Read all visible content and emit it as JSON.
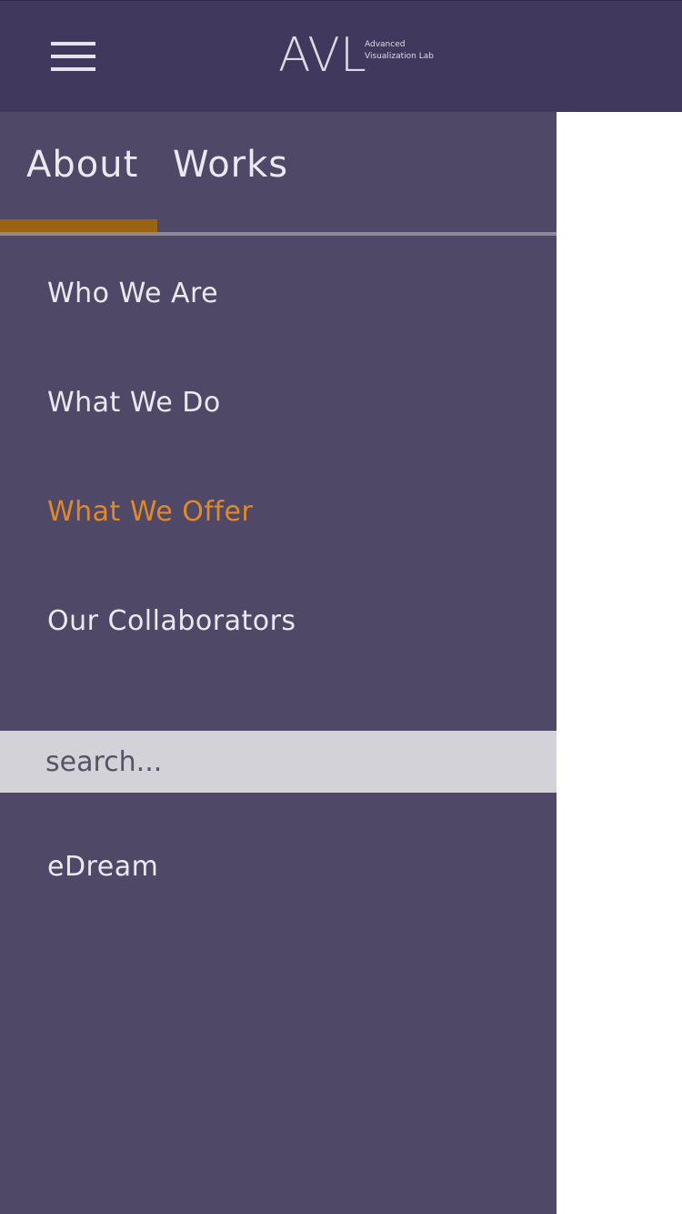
{
  "header": {
    "logo_text": "AVL",
    "logo_subtitle": "Advanced\nVisualization Lab"
  },
  "drawer": {
    "tabs": [
      {
        "label": "About",
        "selected": true
      },
      {
        "label": "Works",
        "selected": false
      }
    ],
    "menu_items": [
      {
        "label": "Who We Are",
        "active": false
      },
      {
        "label": "What We Do",
        "active": false
      },
      {
        "label": "What We Offer",
        "active": true
      },
      {
        "label": "Our Collaborators",
        "active": false
      }
    ],
    "search": {
      "placeholder": "search...",
      "value": ""
    },
    "extra_link": "eDream"
  },
  "colors": {
    "header_bg": "#41385d",
    "drawer_bg": "#4f4866",
    "accent": "#e0892b",
    "tab_indicator": "#9a6312",
    "search_bg": "#d3d2d8"
  }
}
